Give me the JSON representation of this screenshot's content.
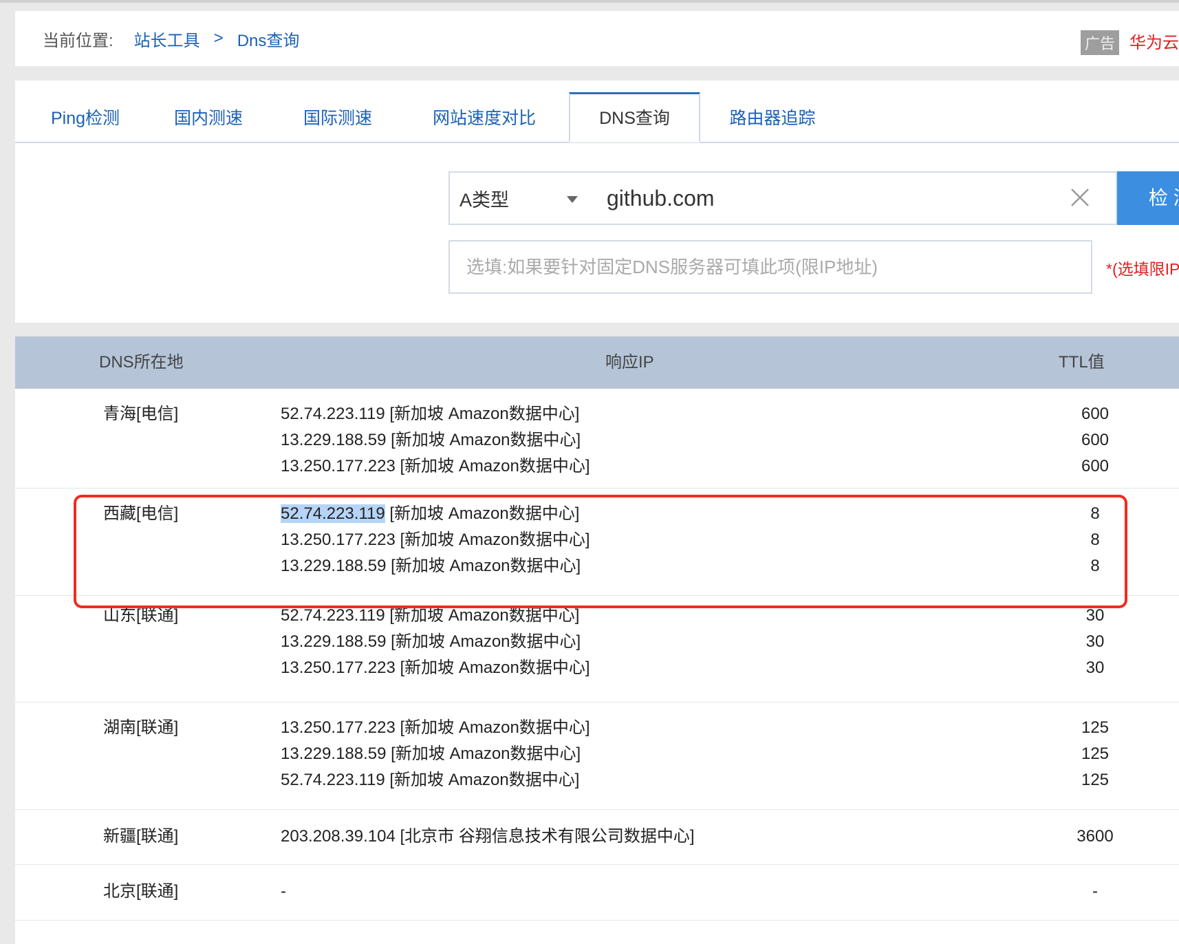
{
  "breadcrumb": {
    "prefix": "当前位置:",
    "home": "站长工具",
    "sep": ">",
    "current": "Dns查询"
  },
  "ad": {
    "badge": "广告",
    "text": "华为云"
  },
  "tabs": [
    {
      "label": "Ping检测"
    },
    {
      "label": "国内测速"
    },
    {
      "label": "国际测速"
    },
    {
      "label": "网站速度对比"
    },
    {
      "label": "DNS查询",
      "active": true
    },
    {
      "label": "路由器追踪"
    }
  ],
  "form": {
    "record_type": "A类型",
    "domain_value": "github.com",
    "check_label": "检 测",
    "dns_server_placeholder": "选填:如果要针对固定DNS服务器可填此项(限IP地址)",
    "hint": "*(选填限IP)"
  },
  "table": {
    "headers": [
      "DNS所在地",
      "响应IP",
      "TTL值"
    ],
    "rows": [
      {
        "loc": "青海[电信]",
        "ips": [
          "52.74.223.119 [新加坡 Amazon数据中心]",
          "13.229.188.59 [新加坡 Amazon数据中心]",
          "13.250.177.223 [新加坡 Amazon数据中心]"
        ],
        "ttls": [
          "600",
          "600",
          "600"
        ]
      },
      {
        "loc": "西藏[电信]",
        "ips": [
          "52.74.223.119",
          "13.250.177.223 [新加坡 Amazon数据中心]",
          "13.229.188.59 [新加坡 Amazon数据中心]"
        ],
        "first_ip_suffix": " [新加坡 Amazon数据中心]",
        "ttls": [
          "8",
          "8",
          "8"
        ],
        "highlighted": true
      },
      {
        "loc": "山东[联通]",
        "ips": [
          "52.74.223.119 [新加坡 Amazon数据中心]",
          "13.229.188.59 [新加坡 Amazon数据中心]",
          "13.250.177.223 [新加坡 Amazon数据中心]"
        ],
        "ttls": [
          "30",
          "30",
          "30"
        ]
      },
      {
        "loc": "湖南[联通]",
        "ips": [
          "13.250.177.223 [新加坡 Amazon数据中心]",
          "13.229.188.59 [新加坡 Amazon数据中心]",
          "52.74.223.119 [新加坡 Amazon数据中心]"
        ],
        "ttls": [
          "125",
          "125",
          "125"
        ]
      },
      {
        "loc": "新疆[联通]",
        "ips": [
          "203.208.39.104 [北京市 谷翔信息技术有限公司数据中心]"
        ],
        "ttls": [
          "3600"
        ]
      },
      {
        "loc": "北京[联通]",
        "ips": [
          "-"
        ],
        "ttls": [
          "-"
        ]
      }
    ]
  },
  "colors": {
    "link": "#1b61b7",
    "header_bg": "#b6c4d8",
    "button": "#3b8ee0",
    "alert": "#e02020",
    "highlight_box": "#f02d1f"
  }
}
